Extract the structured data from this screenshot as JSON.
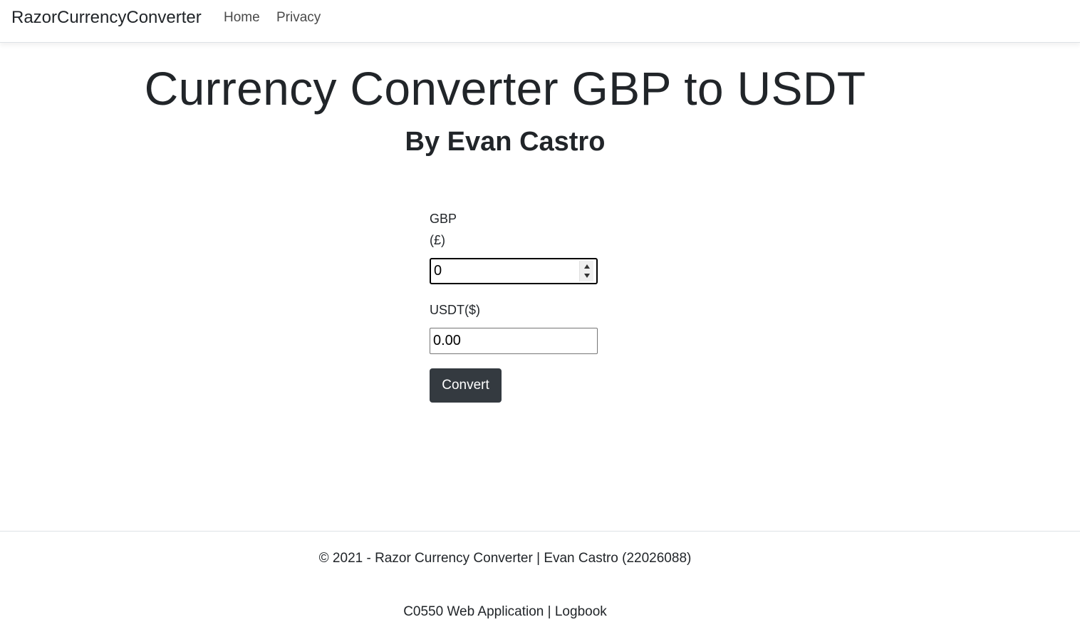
{
  "nav": {
    "brand": "RazorCurrencyConverter",
    "links": [
      "Home",
      "Privacy"
    ]
  },
  "main": {
    "title": "Currency Converter GBP to USDT",
    "byline": "By Evan Castro",
    "gbp_label": "GBP",
    "gbp_symbol": "(£)",
    "gbp_value": "0",
    "usdt_label": "USDT($)",
    "usdt_value": "0.00",
    "convert_label": "Convert"
  },
  "footer": {
    "line1": "© 2021 - Razor Currency Converter | Evan Castro (22026088)",
    "line2": "C0550 Web Application | Logbook"
  },
  "colors": {
    "button_bg": "#343a40",
    "text": "#212529",
    "border": "#dee2e6"
  }
}
